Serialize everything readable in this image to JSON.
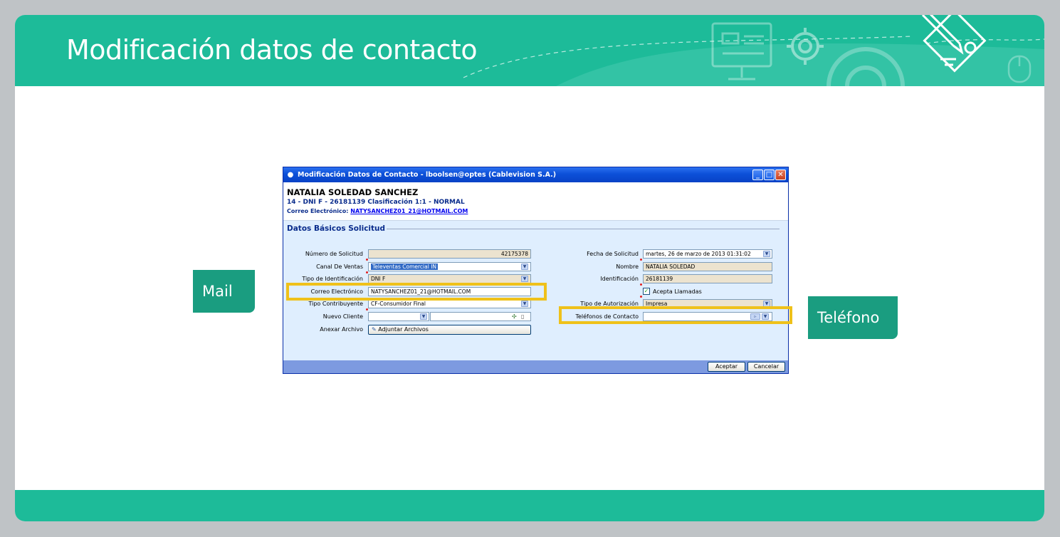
{
  "slide": {
    "title": "Modificación datos de contacto",
    "callouts": {
      "mail": "Mail",
      "telefono": "Teléfono"
    },
    "colors": {
      "header": "#1dbb99",
      "callout": "#1a9d80",
      "highlight": "#efc11a"
    }
  },
  "window": {
    "title": "Modificación Datos de Contacto - lboolsen@optes (Cablevision S.A.)",
    "customer": {
      "name": "NATALIA SOLEDAD SANCHEZ",
      "line": "14 - DNI F - 26181139 Clasificación 1:1 - NORMAL",
      "email_label": "Correo Electrónico:",
      "email_value": "NATYSANCHEZ01_21@HOTMAIL.COM"
    },
    "section_title": "Datos Básicos Solicitud",
    "left_fields": {
      "numero": {
        "label": "Número de Solicitud",
        "value": "42175378"
      },
      "canal": {
        "label": "Canal De Ventas",
        "value": "Televentas Comercial IN"
      },
      "tipo_id": {
        "label": "Tipo de Identificación",
        "value": "DNI F"
      },
      "correo": {
        "label": "Correo Electrónico",
        "value": "NATYSANCHEZ01_21@HOTMAIL.COM"
      },
      "contribuyente": {
        "label": "Tipo Contribuyente",
        "value": "CF-Consumidor Final"
      },
      "nuevo_cliente": {
        "label": "Nuevo Cliente",
        "value": ""
      },
      "anexar": {
        "label": "Anexar Archivo",
        "button": "Adjuntar Archivos"
      }
    },
    "right_fields": {
      "fecha": {
        "label": "Fecha de Solicitud",
        "value": "martes, 26 de marzo de 2013 01:31:02"
      },
      "nombre": {
        "label": "Nombre",
        "value": "NATALIA SOLEDAD"
      },
      "identificacion": {
        "label": "Identificación",
        "value": "26181139"
      },
      "acepta": {
        "label": "Acepta Llamadas",
        "checked": true
      },
      "autorizacion": {
        "label": "Tipo de Autorización",
        "value": "Impresa"
      },
      "telefonos": {
        "label": "Teléfonos de Contacto",
        "value": ""
      }
    },
    "buttons": {
      "accept": "Aceptar",
      "cancel": "Cancelar"
    },
    "icons": {
      "app": "cablevision-icon",
      "minimize": "minimize-icon",
      "maximize": "maximize-icon",
      "close": "close-icon"
    }
  }
}
